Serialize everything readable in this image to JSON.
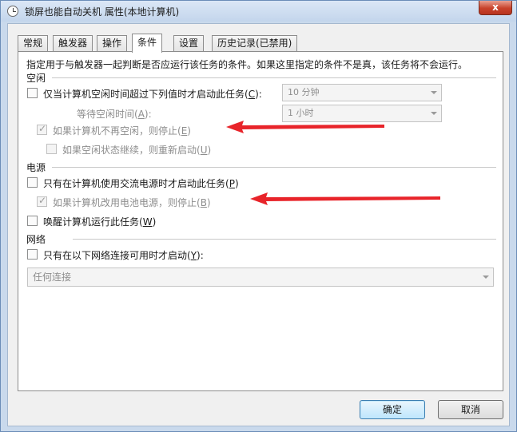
{
  "window": {
    "title": "锁屏也能自动关机 属性(本地计算机)",
    "close_label": "x"
  },
  "tabs": [
    {
      "label": "常规",
      "active": false
    },
    {
      "label": "触发器",
      "active": false
    },
    {
      "label": "操作",
      "active": false
    },
    {
      "label": "条件",
      "active": true
    },
    {
      "label": "设置",
      "active": false
    },
    {
      "label": "历史记录(已禁用)",
      "active": false
    }
  ],
  "description": "指定用于与触发器一起判断是否应运行该任务的条件。如果这里指定的条件不是真，该任务将不会运行。",
  "idle": {
    "header": "空闲",
    "start_if_idle": {
      "label": "仅当计算机空闲时间超过下列值时才启动此任务(",
      "key": "C",
      "suffix": "):",
      "checked": false
    },
    "idle_for_value": "10 分钟",
    "wait_for_idle": {
      "label": "等待空闲时间(",
      "key": "A",
      "suffix": "):"
    },
    "wait_value": "1 小时",
    "stop_if_not_idle": {
      "label": "如果计算机不再空闲，则停止(",
      "key": "E",
      "suffix": ")",
      "checked": true
    },
    "restart_if_idle": {
      "label": "如果空闲状态继续，则重新启动(",
      "key": "U",
      "suffix": ")",
      "checked": false
    }
  },
  "power": {
    "header": "电源",
    "ac_only": {
      "label": "只有在计算机使用交流电源时才启动此任务(",
      "key": "P",
      "suffix": ")",
      "checked": false
    },
    "stop_on_battery": {
      "label": "如果计算机改用电池电源，则停止(",
      "key": "B",
      "suffix": ")",
      "checked": true
    },
    "wake": {
      "label": "唤醒计算机运行此任务(",
      "key": "W",
      "suffix": ")",
      "checked": false
    }
  },
  "network": {
    "header": "网络",
    "only_if_network": {
      "label": "只有在以下网络连接可用时才启动(",
      "key": "Y",
      "suffix": "):",
      "checked": false
    },
    "connection_value": "任何连接"
  },
  "buttons": {
    "ok": "确定",
    "cancel": "取消"
  },
  "colors": {
    "annotation_arrow": "#e8242a"
  }
}
